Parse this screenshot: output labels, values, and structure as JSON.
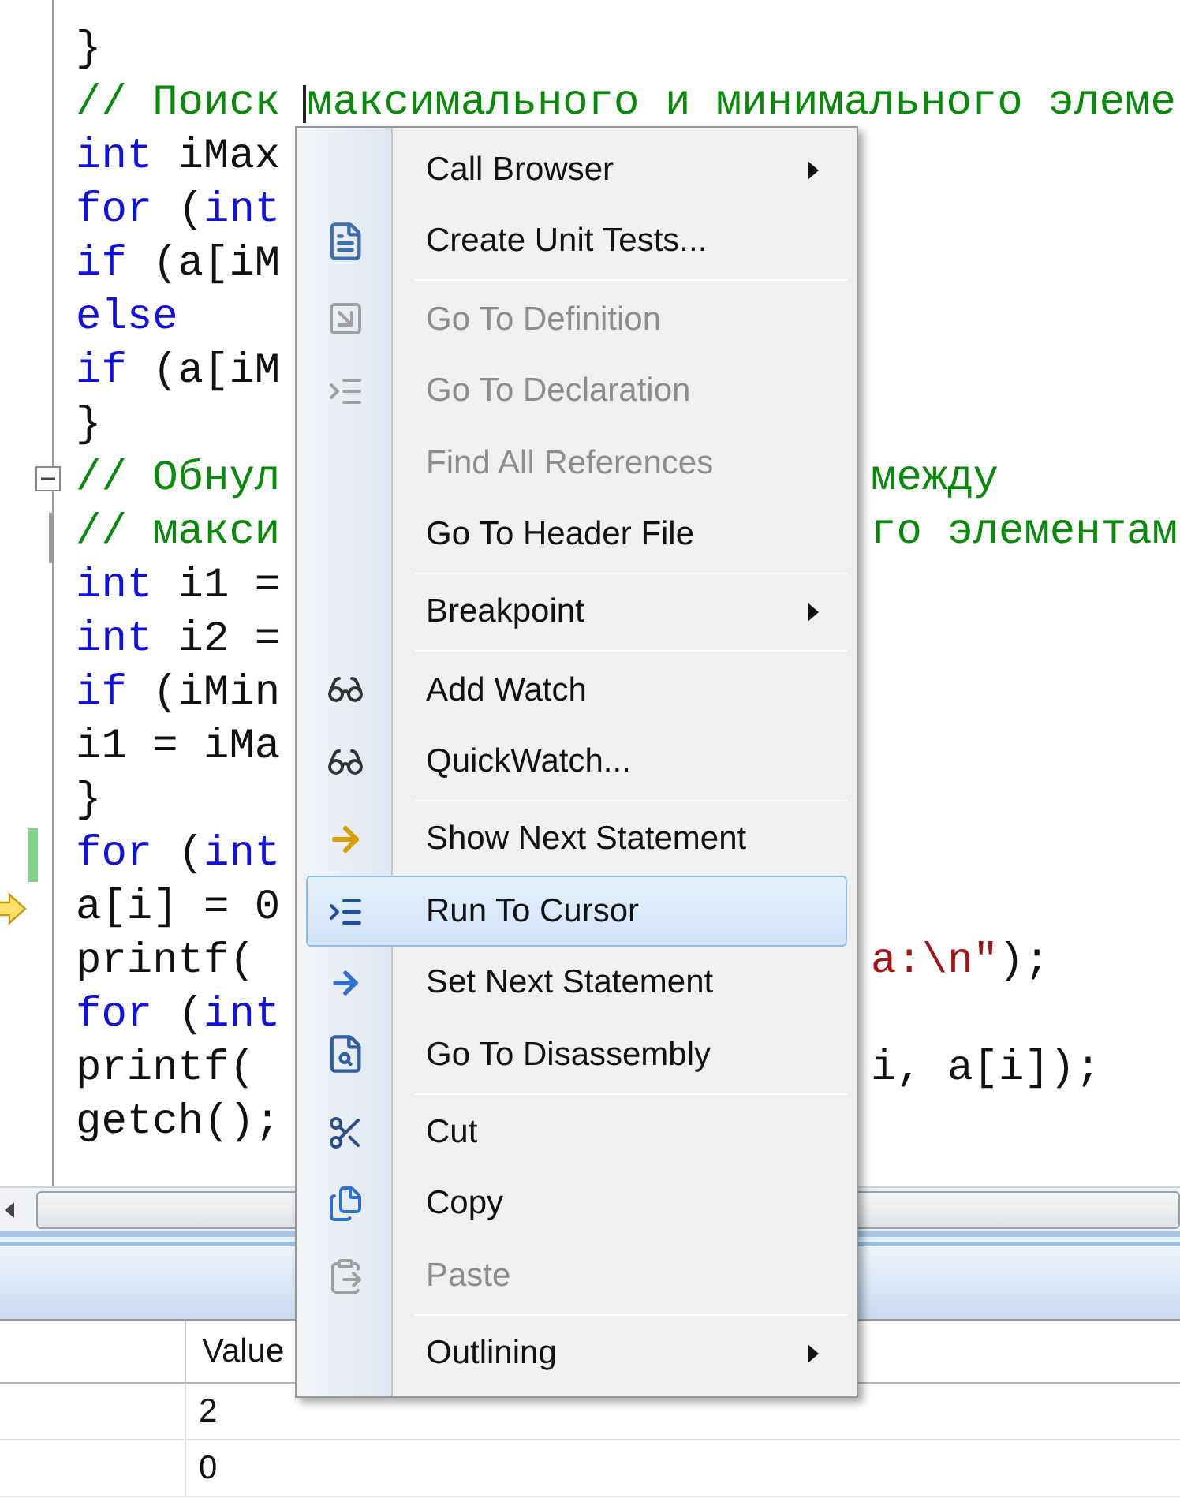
{
  "editor": {
    "lines": [
      {
        "left": [
          {
            "kind": "txt",
            "text": "}"
          }
        ]
      },
      {
        "left": [
          {
            "kind": "cmt",
            "text": "// Поиск"
          }
        ],
        "after_caret": [
          {
            "kind": "cmt",
            "text": "максимального и минимального элеме"
          }
        ]
      },
      {
        "left": [
          {
            "kind": "kw",
            "text": "int"
          },
          {
            "kind": "txt",
            "text": " iMax"
          }
        ]
      },
      {
        "left": [
          {
            "kind": "kw",
            "text": "for"
          },
          {
            "kind": "txt",
            "text": " ("
          },
          {
            "kind": "kw",
            "text": "int"
          }
        ]
      },
      {
        "left": [
          {
            "kind": "kw",
            "text": "if"
          },
          {
            "kind": "txt",
            "text": " (a[iM"
          }
        ]
      },
      {
        "left": [
          {
            "kind": "kw",
            "text": "else"
          }
        ]
      },
      {
        "left": [
          {
            "kind": "kw",
            "text": "if"
          },
          {
            "kind": "txt",
            "text": " (a[iM"
          }
        ]
      },
      {
        "left": [
          {
            "kind": "txt",
            "text": "}"
          }
        ]
      },
      {
        "collapsible": true,
        "left": [
          {
            "kind": "cmt",
            "text": "// Обнул"
          }
        ],
        "right": [
          {
            "kind": "cmt",
            "text": "между"
          }
        ]
      },
      {
        "left": [
          {
            "kind": "cmt",
            "text": "// макси"
          }
        ],
        "right": [
          {
            "kind": "cmt",
            "text": "го элементам"
          }
        ]
      },
      {
        "left": [
          {
            "kind": "kw",
            "text": "int"
          },
          {
            "kind": "txt",
            "text": " i1 ="
          }
        ]
      },
      {
        "left": [
          {
            "kind": "kw",
            "text": "int"
          },
          {
            "kind": "txt",
            "text": " i2 ="
          }
        ]
      },
      {
        "left": [
          {
            "kind": "kw",
            "text": "if"
          },
          {
            "kind": "txt",
            "text": " (iMin"
          }
        ]
      },
      {
        "left": [
          {
            "kind": "txt",
            "text": "i1 = iMa"
          }
        ]
      },
      {
        "left": [
          {
            "kind": "txt",
            "text": "}"
          }
        ]
      },
      {
        "changed": true,
        "left": [
          {
            "kind": "kw",
            "text": "for"
          },
          {
            "kind": "txt",
            "text": " ("
          },
          {
            "kind": "kw",
            "text": "int"
          }
        ]
      },
      {
        "current": true,
        "left": [
          {
            "kind": "txt",
            "text": "a[i] = 0"
          }
        ]
      },
      {
        "left": [
          {
            "kind": "txt",
            "text": "printf("
          }
        ],
        "right": [
          {
            "kind": "str",
            "text": "a:\\n\""
          },
          {
            "kind": "txt",
            "text": ");"
          }
        ]
      },
      {
        "left": [
          {
            "kind": "kw",
            "text": "for"
          },
          {
            "kind": "txt",
            "text": " ("
          },
          {
            "kind": "kw",
            "text": "int"
          }
        ]
      },
      {
        "left": [
          {
            "kind": "txt",
            "text": "printf("
          }
        ],
        "right": [
          {
            "kind": "txt",
            "text": "i, a[i]);"
          }
        ]
      },
      {
        "left": [
          {
            "kind": "txt",
            "text": "getch();"
          }
        ]
      }
    ]
  },
  "context_menu": {
    "items": [
      {
        "kind": "item",
        "label": "Call Browser",
        "disabled": false,
        "selected": false,
        "submenu": true
      },
      {
        "kind": "item",
        "label": "Create Unit Tests...",
        "disabled": false,
        "selected": false,
        "submenu": false
      },
      {
        "kind": "separator"
      },
      {
        "kind": "item",
        "label": "Go To Definition",
        "disabled": true,
        "selected": false,
        "submenu": false
      },
      {
        "kind": "item",
        "label": "Go To Declaration",
        "disabled": true,
        "selected": false,
        "submenu": false
      },
      {
        "kind": "item",
        "label": "Find All References",
        "disabled": true,
        "selected": false,
        "submenu": false
      },
      {
        "kind": "item",
        "label": "Go To Header File",
        "disabled": false,
        "selected": false,
        "submenu": false
      },
      {
        "kind": "separator"
      },
      {
        "kind": "item",
        "label": "Breakpoint",
        "disabled": false,
        "selected": false,
        "submenu": true
      },
      {
        "kind": "separator"
      },
      {
        "kind": "item",
        "label": "Add Watch",
        "disabled": false,
        "selected": false,
        "submenu": false
      },
      {
        "kind": "item",
        "label": "QuickWatch...",
        "disabled": false,
        "selected": false,
        "submenu": false
      },
      {
        "kind": "separator"
      },
      {
        "kind": "item",
        "label": "Show Next Statement",
        "disabled": false,
        "selected": false,
        "submenu": false
      },
      {
        "kind": "item",
        "label": "Run To Cursor",
        "disabled": false,
        "selected": true,
        "submenu": false
      },
      {
        "kind": "item",
        "label": "Set Next Statement",
        "disabled": false,
        "selected": false,
        "submenu": false
      },
      {
        "kind": "item",
        "label": "Go To Disassembly",
        "disabled": false,
        "selected": false,
        "submenu": false
      },
      {
        "kind": "separator"
      },
      {
        "kind": "item",
        "label": "Cut",
        "disabled": false,
        "selected": false,
        "submenu": false
      },
      {
        "kind": "item",
        "label": "Copy",
        "disabled": false,
        "selected": false,
        "submenu": false
      },
      {
        "kind": "item",
        "label": "Paste",
        "disabled": true,
        "selected": false,
        "submenu": false
      },
      {
        "kind": "separator"
      },
      {
        "kind": "item",
        "label": "Outlining",
        "disabled": false,
        "selected": false,
        "submenu": true
      }
    ]
  },
  "watch_table": {
    "columns": [
      {
        "label": "Value"
      }
    ],
    "rows": [
      {
        "value": "2"
      },
      {
        "value": "0"
      }
    ]
  }
}
